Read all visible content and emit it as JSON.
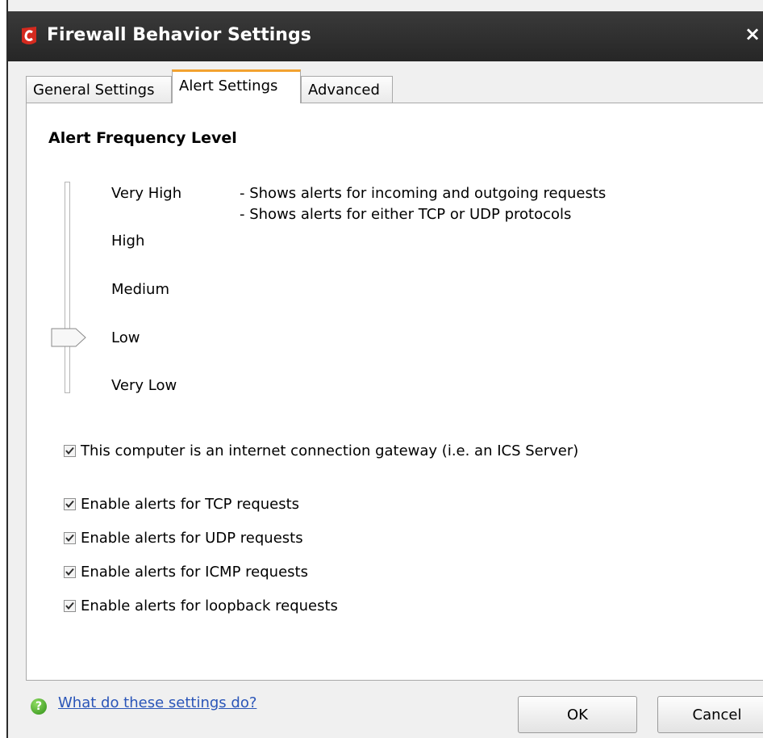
{
  "window": {
    "title": "Firewall Behavior Settings",
    "close_glyph": "×"
  },
  "tabs": [
    {
      "label": "General Settings",
      "selected": false
    },
    {
      "label": "Alert Settings",
      "selected": true
    },
    {
      "label": "Advanced",
      "selected": false
    }
  ],
  "alert_frequency": {
    "heading": "Alert Frequency Level",
    "levels": [
      "Very High",
      "High",
      "Medium",
      "Low",
      "Very Low"
    ],
    "selected_level": "Low",
    "descriptions": [
      "- Shows alerts for incoming and outgoing requests",
      "- Shows alerts for either TCP or UDP protocols"
    ]
  },
  "options": [
    {
      "label": "This computer is an internet connection gateway (i.e. an ICS Server)",
      "checked": true
    },
    {
      "label": "Enable alerts for TCP requests",
      "checked": true
    },
    {
      "label": "Enable alerts for UDP requests",
      "checked": true
    },
    {
      "label": "Enable alerts for ICMP requests",
      "checked": true
    },
    {
      "label": "Enable alerts for loopback requests",
      "checked": true
    }
  ],
  "footer": {
    "help_link": "What do these settings do?",
    "help_icon": "help-icon",
    "ok_label": "OK",
    "cancel_label": "Cancel"
  },
  "colors": {
    "titlebar": "#2d2d2d",
    "selected_tab_accent": "#f2a230",
    "link": "#2a55b8",
    "brand_red": "#d42a1f"
  }
}
